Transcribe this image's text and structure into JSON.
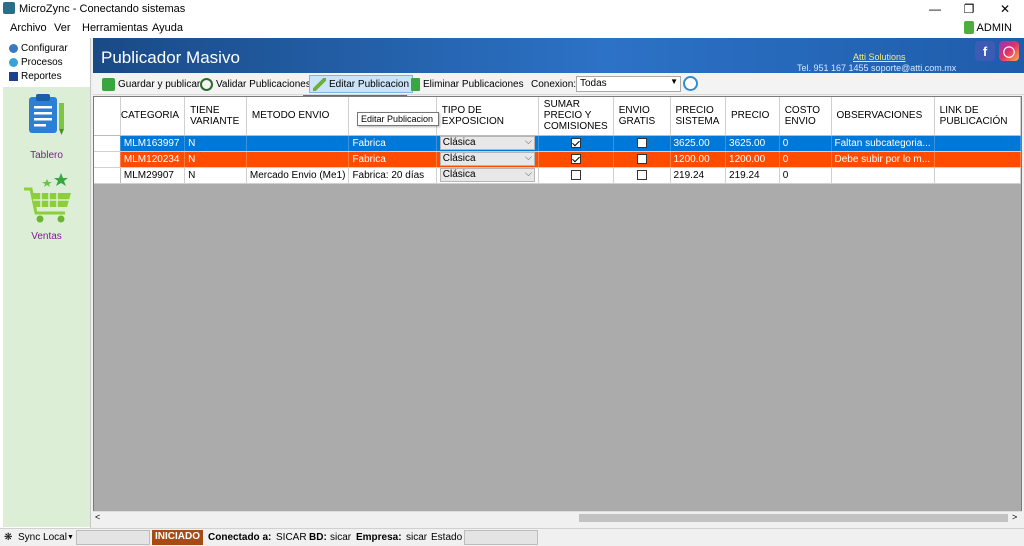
{
  "window": {
    "title": "MicroZync - Conectando sistemas"
  },
  "menu": {
    "items": [
      "Archivo",
      "Ver",
      "Herramientas",
      "Ayuda"
    ],
    "user": "ADMIN"
  },
  "tree": {
    "items": [
      "Configurar",
      "Procesos",
      "Reportes"
    ]
  },
  "nav": {
    "tablero": "Tablero",
    "ventas": "Ventas"
  },
  "header": {
    "title": "Publicador Masivo",
    "company": "Atti Solutions",
    "contact": "Tel. 951 167 1455  soporte@atti.com.mx"
  },
  "toolbar": {
    "guardar": "Guardar y publicar",
    "validar": "Validar Publicaciones",
    "editar": "Editar Publicacion",
    "eliminar": "Eliminar Publicaciones",
    "conexion_label": "Conexion:",
    "conexion_value": "Todas",
    "tooltip": "Editar Publicacion"
  },
  "grid": {
    "columns": [
      "CATEGORIA",
      "TIENE VARIANTE",
      "METODO ENVIO",
      "",
      "TIPO DE EXPOSICION",
      "SUMAR PRECIO Y COMISIONES",
      "ENVIO GRATIS",
      "PRECIO SISTEMA",
      "PRECIO",
      "COSTO ENVIO",
      "OBSERVACIONES",
      "LINK DE PUBLICACIÓN"
    ],
    "rows": [
      {
        "categoria": "MLM163997",
        "variante": "N",
        "metodo": "",
        "fabrica": "Fabrica",
        "exposicion": "Clásica",
        "sumar": true,
        "gratis": false,
        "precio_sistema": "3625.00",
        "precio": "3625.00",
        "costo": "0",
        "observaciones": "Faltan subcategoria...",
        "link": ""
      },
      {
        "categoria": "MLM120234",
        "variante": "N",
        "metodo": "",
        "fabrica": "Fabrica",
        "exposicion": "Clásica",
        "sumar": true,
        "gratis": false,
        "precio_sistema": "1200.00",
        "precio": "1200.00",
        "costo": "0",
        "observaciones": "Debe subir por lo m...",
        "link": ""
      },
      {
        "categoria": "MLM29907",
        "variante": "N",
        "metodo": "Mercado Envio (Me1)",
        "fabrica": "Fabrica: 20 días",
        "exposicion": "Clásica",
        "sumar": false,
        "gratis": false,
        "precio_sistema": "219.24",
        "precio": "219.24",
        "costo": "0",
        "observaciones": "",
        "link": ""
      }
    ]
  },
  "status": {
    "sync": "Sync Local",
    "state": "INICIADO",
    "conectado_label": "Conectado a:",
    "conectado_value": "SICAR",
    "bd_label": "BD:",
    "bd_value": "sicar",
    "empresa_label": "Empresa:",
    "empresa_value": "sicar",
    "estado_label": "Estado"
  },
  "colors": {
    "selected": "#0078d7",
    "error": "#ff4c00",
    "banner": "#2c72c6",
    "nav_bg": "#dcefd6"
  }
}
